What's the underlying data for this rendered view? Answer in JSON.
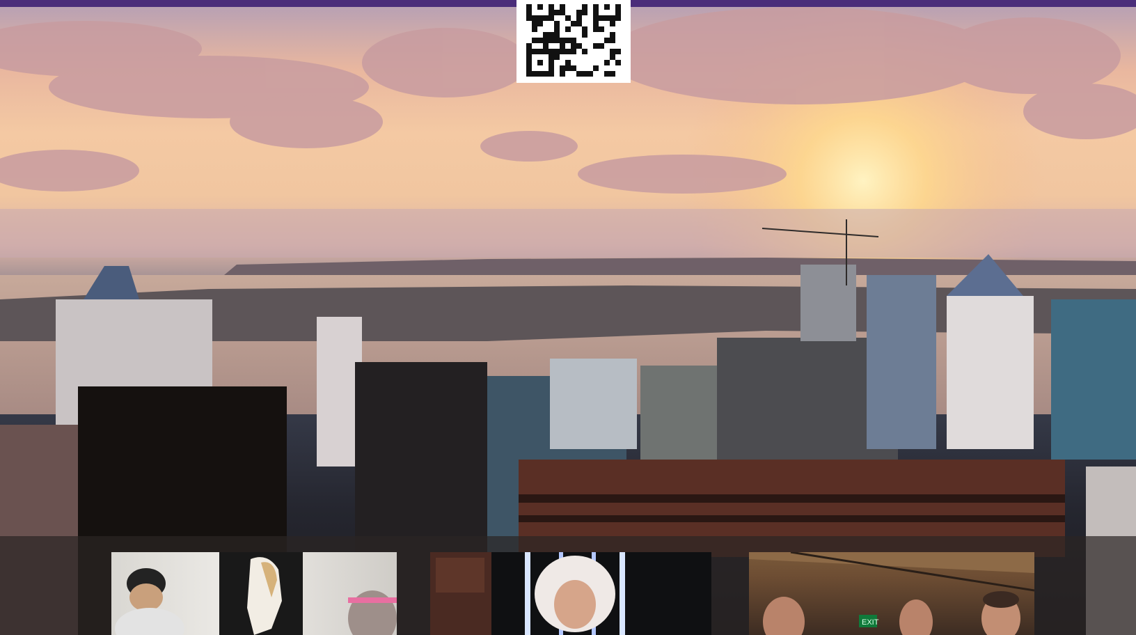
{
  "page": {
    "qr_code": {
      "icon": "qr-code-icon"
    },
    "hero": {
      "scene": "city-skyline-sunset-image"
    },
    "photos": [
      {
        "icon": "gallery-photo-art-class"
      },
      {
        "icon": "gallery-photo-portrait"
      },
      {
        "icon": "gallery-photo-group"
      }
    ],
    "exit_sign": "EXIT"
  },
  "colors": {
    "top_bar": "#4a2d7a",
    "sunset": "#f4c9a3",
    "qr_background": "#ffffff"
  }
}
